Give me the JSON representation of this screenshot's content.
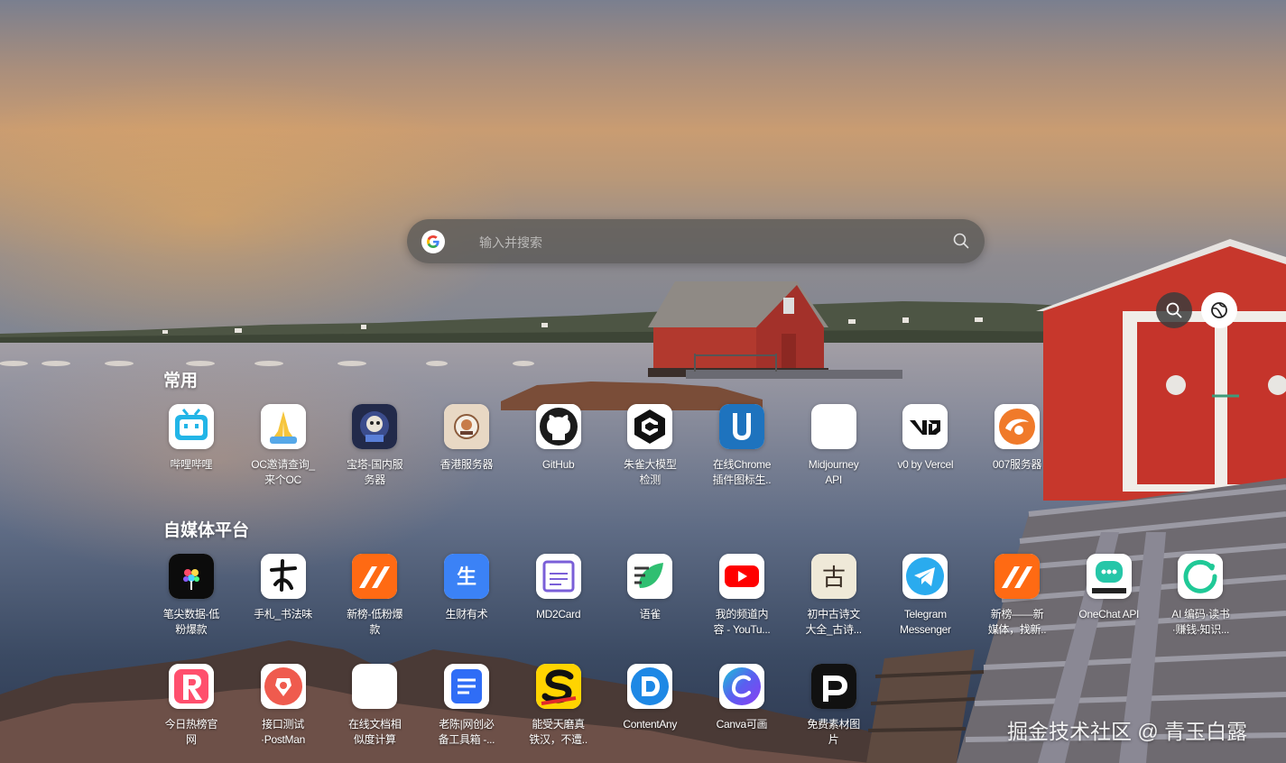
{
  "search": {
    "placeholder": "输入并搜索"
  },
  "sections": [
    {
      "title": "常用",
      "apps": [
        {
          "label": "哔哩哔哩",
          "icon": "bilibili-icon"
        },
        {
          "label": "OC邀请查询_\n来个OC",
          "icon": "praying-hands-icon"
        },
        {
          "label": "宝塔-国内服\n务器",
          "icon": "baota-icon"
        },
        {
          "label": "香港服务器",
          "icon": "hk-server-icon"
        },
        {
          "label": "GitHub",
          "icon": "github-icon"
        },
        {
          "label": "朱雀大模型\n检测",
          "icon": "zhuque-icon"
        },
        {
          "label": "在线Chrome\n插件图标生..",
          "icon": "u-icon"
        },
        {
          "label": "Midjourney\nAPI",
          "icon": "blank-icon"
        },
        {
          "label": "v0 by Vercel",
          "icon": "v0-icon"
        },
        {
          "label": "007服务器",
          "icon": "server-007-icon"
        }
      ]
    },
    {
      "title": "自媒体平台",
      "apps": [
        {
          "label": "笔尖数据-低\n粉爆款",
          "icon": "bijian-icon"
        },
        {
          "label": "手札_书法味",
          "icon": "calligraphy-icon"
        },
        {
          "label": "新榜-低粉爆\n款",
          "icon": "xinbang-icon"
        },
        {
          "label": "生财有术",
          "icon": "shengcai-icon"
        },
        {
          "label": "MD2Card",
          "icon": "md2card-icon"
        },
        {
          "label": "语雀",
          "icon": "yuque-icon"
        },
        {
          "label": "我的频道内\n容 - YouTu...",
          "icon": "youtube-icon"
        },
        {
          "label": "初中古诗文\n大全_古诗...",
          "icon": "gushi-icon"
        },
        {
          "label": "Telegram\nMessenger",
          "icon": "telegram-icon"
        },
        {
          "label": "新榜——新\n媒体，找新..",
          "icon": "xinbang-icon"
        },
        {
          "label": "OneChat API",
          "icon": "onechat-icon"
        },
        {
          "label": "AI 编码·读书\n·赚钱-知识...",
          "icon": "ai-ring-icon"
        }
      ]
    },
    {
      "title": "",
      "apps": [
        {
          "label": "今日热榜官\n网",
          "icon": "r-icon"
        },
        {
          "label": "接口测试\n·PostMan",
          "icon": "postman-icon"
        },
        {
          "label": "在线文档相\n似度计算",
          "icon": "blank-icon"
        },
        {
          "label": "老陈|网创必\n备工具箱 -...",
          "icon": "doc-icon"
        },
        {
          "label": "能受天磨真\n铁汉，不遭..",
          "icon": "s-icon"
        },
        {
          "label": "ContentAny",
          "icon": "contentany-icon"
        },
        {
          "label": "Canva可画",
          "icon": "canva-icon"
        },
        {
          "label": "免费素材图\n片",
          "icon": "p-icon"
        }
      ]
    }
  ],
  "watermark": "掘金技术社区 @ 青玉白露"
}
